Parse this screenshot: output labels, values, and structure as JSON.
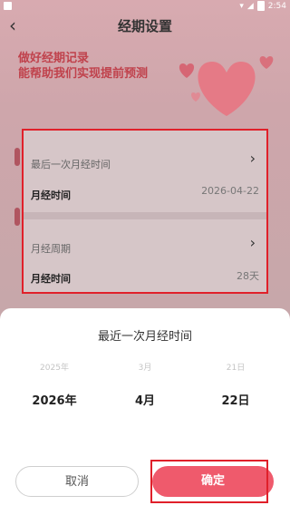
{
  "status_bar": {
    "time": "2:54"
  },
  "header": {
    "title": "经期设置",
    "back_icon": "chevron-left-icon"
  },
  "banner": {
    "line1": "做好经期记录",
    "line2": "能帮助我们实现提前预测"
  },
  "settings": {
    "rows": [
      {
        "title": "最后一次月经时间",
        "sub_label": "月经时间",
        "value": "2026-04-22"
      },
      {
        "title": "月经周期",
        "sub_label": "月经时间",
        "value": "28天"
      }
    ]
  },
  "sheet": {
    "title": "最近一次月经时间",
    "year": {
      "prev": "2025年",
      "selected": "2026年"
    },
    "month": {
      "prev": "3月",
      "selected": "4月"
    },
    "day": {
      "prev": "21日",
      "selected": "22日"
    },
    "cancel_label": "取消",
    "confirm_label": "确定"
  },
  "colors": {
    "accent": "#ef5a6c",
    "highlight_border": "#e0202a"
  }
}
